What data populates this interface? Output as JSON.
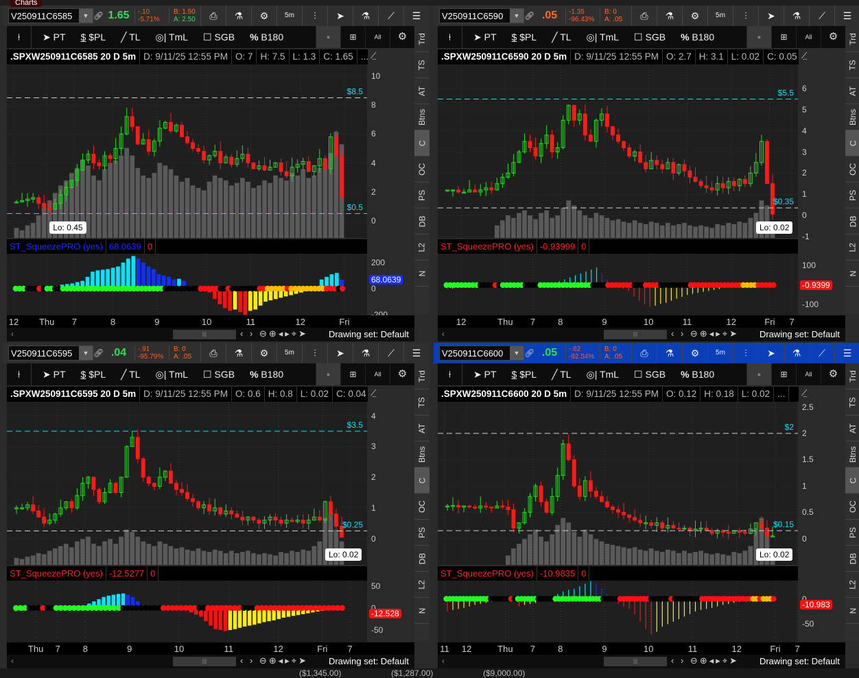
{
  "app": {
    "tab": "Charts"
  },
  "toolbar": {
    "interval": "5m"
  },
  "drawing_tools": [
    "PT",
    "$PL",
    "TL",
    "TmL",
    "SGB",
    "B180"
  ],
  "drawing_right": [
    "All"
  ],
  "side_tabs": [
    "Trd",
    "TS",
    "AT",
    "Btns",
    "C",
    "OC",
    "PS",
    "DB",
    "L2",
    "N"
  ],
  "drawing_set": "Drawing set: Default",
  "colors": {
    "up": "#22e022",
    "down": "#ff1a1a",
    "cyan": "#00e5ff",
    "blue": "#1030ff",
    "red": "#ff1010",
    "yellow": "#ffee00",
    "green": "#22ff22",
    "orange": "#ffbb00",
    "volume": "#5a5a5a"
  },
  "footer": [
    "($1,345.00)",
    "($1,287.00)",
    "($9,000.00)"
  ],
  "panels": [
    {
      "symbol": "V250911C6585",
      "last": "1.65",
      "last_color": "#33dd55",
      "change": "-.10",
      "change_pct": "-5.71%",
      "bid": "B: 1.50",
      "ask": "A: 2.50",
      "bid_color": "#ff6a1f",
      "ask_color": "#33dd55",
      "active": false,
      "info": {
        "title": ".SPXW250911C6585 20 D 5m",
        "date": "D: 9/11/25 12:55 PM",
        "open": "O: 7",
        "high": "H: 7.5",
        "low": "L: 1.3",
        "close": "C: 1.65",
        "more": "..."
      },
      "ylim": [
        -1.18,
        10.8
      ],
      "price_ticks": [
        0,
        2,
        4,
        6,
        8,
        10
      ],
      "price_lines": [
        {
          "label": "$8.5",
          "value": 8.5,
          "line": "#cfcfcf",
          "text": "#00e5ff"
        },
        {
          "label": "$0.5",
          "value": 0.5,
          "line": "#00e5ff",
          "text": "#00e5ff"
        }
      ],
      "lo_label": "Lo: 0.45",
      "lo_bar": 6,
      "closes": [
        1.3,
        1.4,
        1.5,
        1.6,
        1.2,
        0.9,
        0.8,
        1.2,
        1.8,
        2.3,
        2.8,
        3.5,
        4.2,
        4.6,
        4.0,
        3.8,
        4.5,
        4.3,
        5.0,
        6.0,
        7.2,
        6.5,
        5.3,
        5.6,
        4.8,
        5.5,
        6.4,
        6.8,
        6.2,
        6.6,
        5.8,
        5.4,
        5.0,
        4.8,
        4.2,
        4.5,
        4.8,
        4.0,
        4.4,
        3.9,
        4.3,
        4.6,
        4.0,
        3.6,
        3.8,
        3.5,
        3.7,
        4.0,
        3.4,
        3.1,
        3.7,
        3.9,
        4.1,
        3.4,
        3.8,
        4.3,
        3.6,
        5.8,
        4.5,
        1.65
      ],
      "volume": [
        8,
        6,
        10,
        12,
        18,
        24,
        30,
        36,
        42,
        46,
        52,
        56,
        62,
        58,
        50,
        46,
        55,
        60,
        62,
        66,
        72,
        66,
        56,
        50,
        48,
        52,
        60,
        58,
        55,
        50,
        45,
        48,
        42,
        40,
        38,
        45,
        50,
        48,
        46,
        42,
        44,
        48,
        45,
        40,
        42,
        46,
        44,
        50,
        48,
        46,
        52,
        50,
        55,
        48,
        50,
        56,
        60,
        68,
        85,
        75
      ],
      "squeeze": {
        "name": "ST_SqueezePRO (yes)",
        "value": "68.0639",
        "zero": "0",
        "name_color": "#1a2cff",
        "value_color": "#1a2cff",
        "current_label": "68.0639",
        "current_bg": "#1a2cff",
        "ylim": [
          -205,
          268
        ],
        "ticks": [
          200,
          0,
          -200
        ],
        "thin": false,
        "hist": [
          -12,
          -10,
          -8,
          -4,
          0,
          0,
          0,
          0,
          20,
          30,
          35,
          40,
          50,
          60,
          90,
          130,
          140,
          145,
          150,
          160,
          170,
          200,
          230,
          250,
          230,
          200,
          170,
          150,
          110,
          100,
          90,
          70,
          75,
          60,
          20,
          5,
          0,
          0,
          -30,
          -80,
          -120,
          -150,
          -170,
          -160,
          -180,
          -200,
          -170,
          -160,
          -130,
          -100,
          -90,
          -80,
          -70,
          -60,
          -50,
          -40,
          -30,
          -20,
          -10,
          -5,
          70,
          90,
          110,
          120,
          68
        ],
        "dots": "gggkkkrkggkkggggggggggggggggggggggggggkkkkkkkkkrrrrrkkrkkkkkkkrrooooorooooooooorrrkr"
      },
      "time_labels": [
        {
          "label": "12",
          "bar": 0
        },
        {
          "label": "Thu",
          "bar": 6
        },
        {
          "label": "7",
          "bar": 11
        },
        {
          "label": "8",
          "bar": 18
        },
        {
          "label": "9",
          "bar": 26
        },
        {
          "label": "10",
          "bar": 35
        },
        {
          "label": "11",
          "bar": 43
        },
        {
          "label": "12",
          "bar": 52
        },
        {
          "label": "Fri",
          "bar": 60
        }
      ]
    },
    {
      "symbol": "V250911C6590",
      "last": ".05",
      "last_color": "#ff6a1f",
      "change": "-1.35",
      "change_pct": "-96.43%",
      "bid": "B: 0",
      "ask": "A: .05",
      "bid_color": "#ff6a1f",
      "ask_color": "#ff6a1f",
      "active": false,
      "info": {
        "title": ".SPXW250911C6590 20 D 5m",
        "date": "D: 9/11/25 12:55 PM",
        "open": "O: 2.7",
        "high": "H: 3.1",
        "low": "L: 0.02",
        "close": "C: 0.05",
        "more": "..."
      },
      "ylim": [
        -1.07,
        7.14
      ],
      "price_ticks": [
        -1,
        0,
        1,
        2,
        3,
        4,
        5,
        6
      ],
      "price_lines": [
        {
          "label": "$5.5",
          "value": 5.5,
          "line": "#00e5ff",
          "text": "#00e5ff"
        },
        {
          "label": "$0.35",
          "value": 0.35,
          "line": "#cfcfcf",
          "text": "#00e5ff"
        }
      ],
      "lo_label": "Lo: 0.02",
      "lo_bar": 59,
      "closes": [
        1.2,
        1.2,
        1.1,
        1.1,
        1.2,
        1.1,
        1.2,
        1.3,
        1.2,
        1.5,
        1.8,
        2.0,
        2.5,
        3.0,
        3.5,
        3.2,
        2.8,
        3.4,
        3.8,
        3.0,
        3.2,
        4.5,
        5.2,
        4.5,
        4.8,
        3.8,
        3.5,
        4.5,
        4.8,
        4.2,
        3.8,
        3.5,
        3.2,
        2.8,
        3.0,
        2.5,
        2.2,
        2.6,
        2.4,
        2.2,
        2.5,
        2.0,
        2.4,
        2.1,
        1.8,
        1.6,
        1.4,
        1.3,
        1.2,
        1.5,
        1.3,
        1.6,
        1.4,
        1.7,
        1.5,
        2.0,
        2.5,
        3.5,
        1.5,
        0.05
      ],
      "volume": [
        0,
        0,
        0,
        0,
        0,
        0,
        0,
        0,
        0,
        10,
        14,
        18,
        16,
        20,
        22,
        18,
        15,
        20,
        22,
        16,
        18,
        24,
        30,
        26,
        22,
        18,
        16,
        20,
        18,
        16,
        14,
        15,
        13,
        12,
        14,
        12,
        11,
        13,
        12,
        10,
        12,
        10,
        11,
        12,
        10,
        9,
        10,
        9,
        8,
        11,
        10,
        12,
        11,
        13,
        12,
        16,
        20,
        30,
        26,
        10
      ],
      "squeeze": {
        "name": "ST_SqueezePRO (yes)",
        "value": "-0.93999",
        "zero": "0",
        "name_color": "#ff2020",
        "value_color": "#ff2020",
        "current_label": "-0.9399",
        "current_bg": "#ff1010",
        "ylim": [
          -155,
          161
        ],
        "ticks": [
          100,
          -100
        ],
        "thin": true,
        "hist": [
          -20,
          -18,
          -15,
          -12,
          -10,
          -8,
          -6,
          -5,
          -4,
          -3,
          -2,
          -1,
          0,
          0,
          0,
          0,
          0,
          0,
          0,
          0,
          10,
          20,
          30,
          40,
          50,
          60,
          70,
          80,
          90,
          60,
          30,
          10,
          0,
          -20,
          -30,
          -60,
          -80,
          -100,
          -110,
          -105,
          -95,
          -90,
          -80,
          -70,
          -60,
          -50,
          -45,
          -40,
          -35,
          -30,
          -25,
          -20,
          -15,
          -12,
          -8,
          -5,
          -3,
          5,
          10,
          12,
          8,
          2
        ],
        "dots": "gggggggggkkkkrkggggggkkkkggggggggggggggkkkkrrrrrrrkkkrrrrkkkkkkkkrrrrrrrrrrrrrroooorrrrr"
      },
      "time_labels": [
        {
          "label": "12",
          "bar": 3
        },
        {
          "label": "Thu",
          "bar": 11
        },
        {
          "label": "7",
          "bar": 16
        },
        {
          "label": "8",
          "bar": 21
        },
        {
          "label": "9",
          "bar": 29
        },
        {
          "label": "10",
          "bar": 37
        },
        {
          "label": "11",
          "bar": 44
        },
        {
          "label": "12",
          "bar": 52
        },
        {
          "label": "Fri",
          "bar": 59
        },
        {
          "label": "7",
          "bar": 63
        }
      ]
    },
    {
      "symbol": "V250911C6595",
      "last": ".04",
      "last_color": "#33dd55",
      "change": "-.91",
      "change_pct": "-95.79%",
      "bid": "B: 0",
      "ask": "A: .05",
      "bid_color": "#ff6a1f",
      "ask_color": "#ff6a1f",
      "active": false,
      "info": {
        "title": ".SPXW250911C6595 20 D 5m",
        "date": "D: 9/11/25 12:55 PM",
        "open": "O: 0.6",
        "high": "H: 0.8",
        "low": "L: 0.02",
        "close": "C: 0.04",
        "more": "..."
      },
      "ylim": [
        -0.86,
        4.46
      ],
      "price_ticks": [
        0,
        1,
        2,
        3,
        4
      ],
      "price_lines": [
        {
          "label": "$3.5",
          "value": 3.5,
          "line": "#00e5ff",
          "text": "#00e5ff"
        },
        {
          "label": "$0.25",
          "value": 0.25,
          "line": "#cfcfcf",
          "text": "#00e5ff"
        }
      ],
      "lo_label": "Lo: 0.02",
      "lo_bar": 59,
      "closes": [
        1.0,
        1.0,
        1.1,
        0.9,
        0.7,
        0.5,
        0.6,
        0.8,
        1.0,
        1.2,
        1.0,
        1.4,
        1.8,
        2.0,
        1.6,
        1.2,
        1.5,
        1.8,
        1.5,
        2.0,
        3.0,
        3.3,
        2.6,
        2.0,
        1.8,
        1.7,
        2.0,
        2.2,
        1.8,
        1.6,
        1.5,
        1.3,
        1.2,
        1.0,
        1.1,
        0.9,
        1.0,
        0.8,
        0.9,
        0.8,
        0.7,
        0.6,
        0.7,
        0.6,
        0.5,
        0.6,
        0.7,
        0.6,
        0.5,
        0.6,
        0.55,
        0.6,
        0.5,
        0.6,
        0.7,
        0.6,
        1.2,
        0.8,
        0.4,
        0.04
      ],
      "volume": [
        6,
        5,
        7,
        8,
        10,
        9,
        12,
        14,
        16,
        18,
        15,
        20,
        22,
        24,
        18,
        16,
        20,
        22,
        18,
        24,
        30,
        28,
        24,
        20,
        18,
        16,
        20,
        18,
        16,
        14,
        15,
        13,
        12,
        14,
        12,
        11,
        13,
        12,
        10,
        12,
        10,
        11,
        12,
        10,
        9,
        10,
        9,
        8,
        11,
        10,
        12,
        11,
        13,
        12,
        16,
        20,
        40,
        44,
        30,
        20
      ],
      "squeeze": {
        "name": "ST_SqueezePRO (yes)",
        "value": "-12.5277",
        "zero": "0",
        "name_color": "#ff2020",
        "value_color": "#ff2020",
        "current_label": "-12.528",
        "current_bg": "#ff1010",
        "ylim": [
          -78,
          62
        ],
        "ticks": [
          50,
          0,
          -50,
          -100
        ],
        "thin": false,
        "hist": [
          -8,
          -6,
          -5,
          -4,
          -3,
          -2,
          0,
          0,
          0,
          0,
          0,
          0,
          0,
          0,
          5,
          10,
          15,
          20,
          25,
          28,
          30,
          32,
          33,
          30,
          25,
          15,
          5,
          0,
          0,
          0,
          0,
          0,
          0,
          0,
          0,
          -5,
          -10,
          -15,
          -20,
          -30,
          -40,
          -48,
          -50,
          -52,
          -50,
          -48,
          -45,
          -42,
          -40,
          -38,
          -35,
          -32,
          -30,
          -28,
          -25,
          -22,
          -20,
          -18,
          -16,
          -14,
          -12,
          -10,
          -8,
          -6,
          -5,
          -4,
          -3,
          -2
        ],
        "dots": "gggkkkrkkgggggggggggggggkkkkkkkkkrrrrrrrrkkrrrrrrrrkkkrrrrrrrrrrrrrrrrrrrr"
      },
      "time_labels": [
        {
          "label": "Thu",
          "bar": 4
        },
        {
          "label": "7",
          "bar": 8
        },
        {
          "label": "8",
          "bar": 13
        },
        {
          "label": "9",
          "bar": 21
        },
        {
          "label": "10",
          "bar": 30
        },
        {
          "label": "11",
          "bar": 39
        },
        {
          "label": "12",
          "bar": 48
        },
        {
          "label": "Fri",
          "bar": 56
        },
        {
          "label": "7",
          "bar": 61
        }
      ]
    },
    {
      "symbol": "V250911C6600",
      "last": ".05",
      "last_color": "#33dd55",
      "change": "-.62",
      "change_pct": "-92.54%",
      "bid": "B: 0",
      "ask": "A: .05",
      "bid_color": "#ff6a1f",
      "ask_color": "#ff6a1f",
      "active": true,
      "info": {
        "title": ".SPXW250911C6600 20 D 5m",
        "date": "D: 9/11/25 12:55 PM",
        "open": "O: 0.12",
        "high": "H: 0.18",
        "low": "L: 0.02",
        "close": "",
        "more": "..."
      },
      "ylim": [
        -0.5,
        2.6
      ],
      "price_ticks": [
        0,
        0.5,
        1,
        1.5,
        2,
        2.5
      ],
      "price_lines": [
        {
          "label": "$2",
          "value": 2,
          "line": "#cfcfcf",
          "text": "#00e5ff"
        },
        {
          "label": "$0.15",
          "value": 0.15,
          "line": "#cfcfcf",
          "text": "#00e5ff"
        }
      ],
      "lo_label": "Lo: 0.02",
      "lo_bar": 59,
      "closes": [
        0.62,
        0.63,
        0.6,
        0.62,
        0.6,
        0.58,
        0.62,
        0.6,
        0.58,
        0.62,
        0.6,
        0.55,
        0.2,
        0.3,
        0.5,
        0.8,
        1.0,
        0.7,
        0.5,
        0.8,
        1.2,
        1.8,
        1.5,
        1.0,
        0.8,
        1.1,
        0.9,
        0.8,
        0.7,
        0.6,
        0.55,
        0.5,
        0.45,
        0.4,
        0.35,
        0.3,
        0.3,
        0.25,
        0.3,
        0.2,
        0.25,
        0.2,
        0.18,
        0.2,
        0.15,
        0.18,
        0.2,
        0.15,
        0.1,
        0.15,
        0.12,
        0.1,
        0.15,
        0.12,
        0.1,
        0.18,
        0.3,
        0.2,
        0.05,
        0.05
      ],
      "volume": [
        0,
        0,
        0,
        0,
        0,
        0,
        0,
        0,
        0,
        0,
        0,
        8,
        14,
        18,
        22,
        26,
        30,
        24,
        20,
        26,
        34,
        40,
        36,
        28,
        24,
        30,
        26,
        22,
        20,
        18,
        17,
        16,
        15,
        14,
        15,
        13,
        12,
        14,
        12,
        11,
        13,
        12,
        10,
        12,
        10,
        11,
        12,
        10,
        9,
        10,
        9,
        8,
        11,
        10,
        12,
        16,
        30,
        40,
        28,
        14
      ],
      "squeeze": {
        "name": "ST_SqueezePRO (yes)",
        "value": "-10.9835",
        "zero": "0",
        "name_color": "#ff2020",
        "value_color": "#ff2020",
        "current_label": "-10.983",
        "current_bg": "#ff1010",
        "ylim": [
          -86,
          36
        ],
        "ticks": [
          0,
          -50
        ],
        "thin": true,
        "hist": [
          -25,
          -22,
          -20,
          -18,
          -15,
          -12,
          -10,
          -8,
          -6,
          -5,
          -4,
          -3,
          -2,
          -15,
          -12,
          -10,
          -8,
          -5,
          -3,
          0,
          10,
          15,
          18,
          20,
          25,
          30,
          35,
          30,
          20,
          10,
          0,
          -10,
          -15,
          -20,
          -30,
          -45,
          -60,
          -70,
          -65,
          -55,
          -50,
          -45,
          -40,
          -35,
          -30,
          -25,
          -22,
          -20,
          -18,
          -15,
          -12,
          -10,
          -8,
          -6,
          -5,
          -4,
          -3,
          -2,
          -1,
          -2
        ],
        "dots": "gggggggggggggkkkkkkrkggggggkkkkkggggggggggggggkkkkkrrrrrrrrrkkkkkkrkkkkkkkkrrrrrrrrrrrrrrroorooor"
      },
      "time_labels": [
        {
          "label": "11",
          "bar": 0
        },
        {
          "label": "12",
          "bar": 4
        },
        {
          "label": "Thu",
          "bar": 11
        },
        {
          "label": "7",
          "bar": 16
        },
        {
          "label": "8",
          "bar": 21
        },
        {
          "label": "9",
          "bar": 29
        },
        {
          "label": "10",
          "bar": 37
        },
        {
          "label": "11",
          "bar": 45
        },
        {
          "label": "12",
          "bar": 53
        },
        {
          "label": "Fri",
          "bar": 60
        },
        {
          "label": "7",
          "bar": 64
        }
      ]
    }
  ]
}
